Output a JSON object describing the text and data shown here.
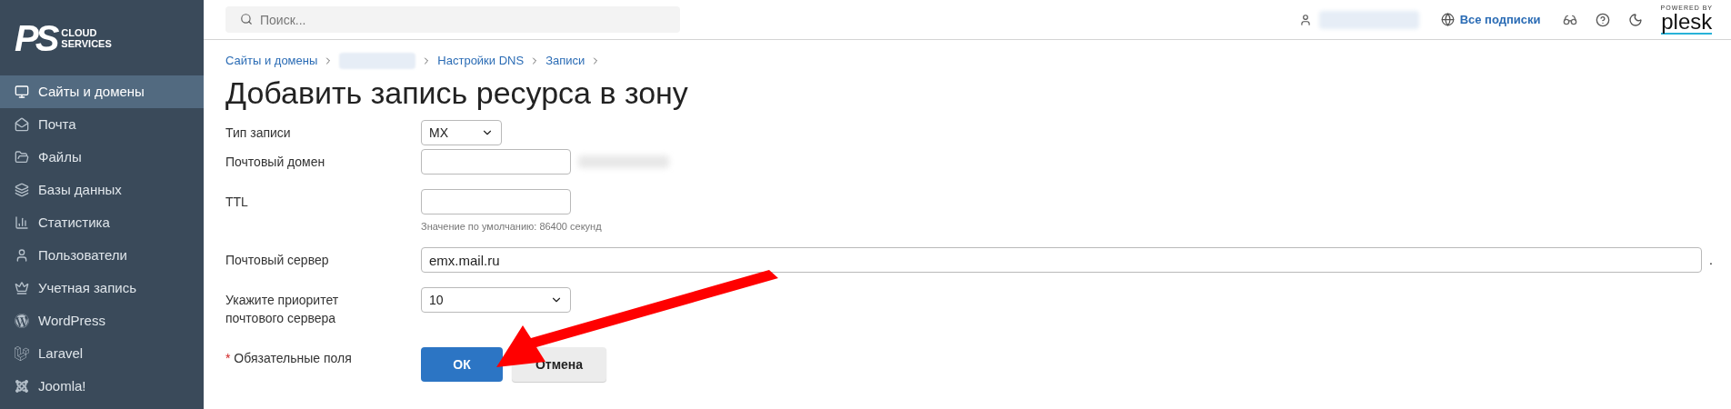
{
  "logo": {
    "mark": "PS",
    "line1": "CLOUD",
    "line2": "SERVICES"
  },
  "sidebar": {
    "items": [
      {
        "label": "Сайты и домены",
        "selected": true
      },
      {
        "label": "Почта",
        "selected": false
      },
      {
        "label": "Файлы",
        "selected": false
      },
      {
        "label": "Базы данных",
        "selected": false
      },
      {
        "label": "Статистика",
        "selected": false
      },
      {
        "label": "Пользователи",
        "selected": false
      },
      {
        "label": "Учетная запись",
        "selected": false
      },
      {
        "label": "WordPress",
        "selected": false
      },
      {
        "label": "Laravel",
        "selected": false
      },
      {
        "label": "Joomla!",
        "selected": false
      }
    ]
  },
  "header": {
    "search": {
      "placeholder": "Поиск..."
    },
    "subscriptions": "Все подписки",
    "powered_by": "POWERED BY",
    "brand": "plesk"
  },
  "breadcrumbs": [
    {
      "label": "Сайты и домены",
      "kind": "link"
    },
    {
      "kind": "blurred"
    },
    {
      "label": "Настройки DNS",
      "kind": "link"
    },
    {
      "label": "Записи",
      "kind": "link"
    }
  ],
  "title": "Добавить запись ресурса в зону",
  "form": {
    "fields": [
      {
        "label": "Тип записи",
        "kind": "select",
        "value": "MX"
      },
      {
        "label": "Почтовый домен",
        "kind": "text"
      },
      {
        "label": "TTL",
        "kind": "text",
        "hint": "Значение по умолчанию: 86400 секунд"
      },
      {
        "label": "Почтовый сервер",
        "kind": "text",
        "value": "emx.mail.ru",
        "suffix": "."
      },
      {
        "label": "Укажите приоритет почтового сервера",
        "kind": "select",
        "value": "10"
      }
    ],
    "required_mark": "*",
    "required_note": "Обязательные поля",
    "buttons": [
      {
        "label": "ОК",
        "kind": "primary"
      },
      {
        "label": "Отмена",
        "kind": "secondary"
      }
    ]
  }
}
